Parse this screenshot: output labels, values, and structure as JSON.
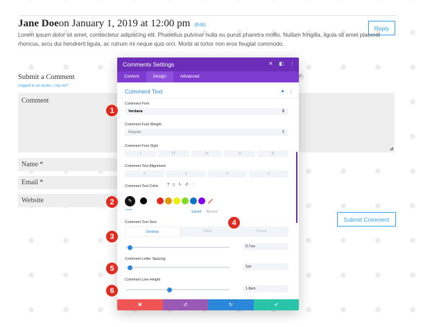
{
  "comment": {
    "author": "Jane Doe",
    "on_date": "on January 1, 2019 at 12:00 pm",
    "edit": "(Edit)",
    "text": "Lorem ipsum dolor sit amet, consectetur adipiscing elit. Phasellus pulvinar nulla eu purus pharetra mollis. Nullam fringilla, ligula sit amet placerat rhoncus, arcu dui hendrerit ligula, ac rutrum mi neque quis orci. Morbi at tortor non eros feugiat commodo.",
    "reply_label": "Reply"
  },
  "form": {
    "title": "Submit a Comment",
    "logged_in": "Logged in as wsdev. Log out?",
    "comment_placeholder": "Comment",
    "name_label": "Name *",
    "email_label": "Email *",
    "website_label": "Website",
    "submit_label": "Submit Comment"
  },
  "modal": {
    "title": "Comments Settings",
    "tabs": [
      {
        "label": "Content"
      },
      {
        "label": "Design"
      },
      {
        "label": "Advanced"
      }
    ],
    "section_title": "Comment Text",
    "font_label": "Comment Font",
    "font_value": "Verdana",
    "weight_label": "Comment Font Weight",
    "weight_value": "Regular",
    "style_label": "Comment Font Style",
    "style_buttons": [
      "I",
      "TT",
      "Tт",
      "U",
      "S"
    ],
    "align_label": "Comment Text Alignment",
    "color_label": "Comment Text Color",
    "color_icons": [
      "?",
      "▯",
      "↖",
      "↺",
      "⋮"
    ],
    "swatches": [
      "#000000",
      "#ffffff",
      "#e02b20",
      "#e09900",
      "#edf000",
      "#7cda24",
      "#0c71c3",
      "#8300e9"
    ],
    "saved_label": "Saved",
    "recent_label": "Recent",
    "size_label": "Comment Text Size",
    "device_tabs": [
      "Desktop",
      "Tablet",
      "Phone"
    ],
    "size_value": "0.7vw",
    "size_level": 0.02,
    "spacing_label": "Comment Letter Spacing",
    "spacing_value": "1px",
    "spacing_level": 0.02,
    "line_height_label": "Comment Line Height",
    "line_height_value": "1.8em",
    "line_height_level": 0.4,
    "footer": [
      "✖",
      "↺",
      "↻",
      "✔"
    ]
  },
  "markers": [
    "1",
    "2",
    "3",
    "4",
    "5",
    "6"
  ]
}
